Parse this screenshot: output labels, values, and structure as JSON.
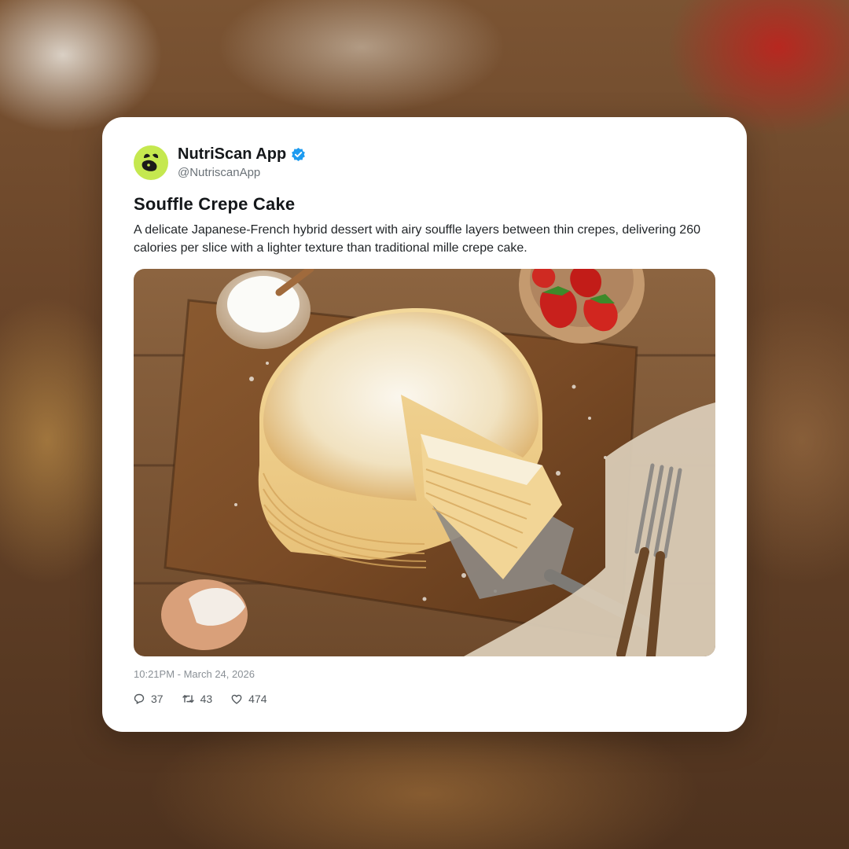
{
  "post": {
    "author_name": "NutriScan App",
    "author_handle": "@NutriscanApp",
    "verified": true,
    "title": "Souffle Crepe Cake",
    "description": "A delicate Japanese-French hybrid dessert with airy souffle layers between thin crepes, delivering 260 calories per slice with a lighter texture than traditional mille crepe cake.",
    "timestamp": "10:21PM - March 24, 2026",
    "stats": {
      "replies": "37",
      "reposts": "43",
      "likes": "474"
    }
  },
  "colors": {
    "avatar_bg": "#c5e84f",
    "verified_badge": "#1d9bf0",
    "card_bg": "#ffffff"
  },
  "icons": {
    "avatar": "leaf-logo-icon",
    "verified": "verified-badge-icon",
    "reply": "comment-icon",
    "repost": "repost-icon",
    "like": "heart-icon"
  }
}
